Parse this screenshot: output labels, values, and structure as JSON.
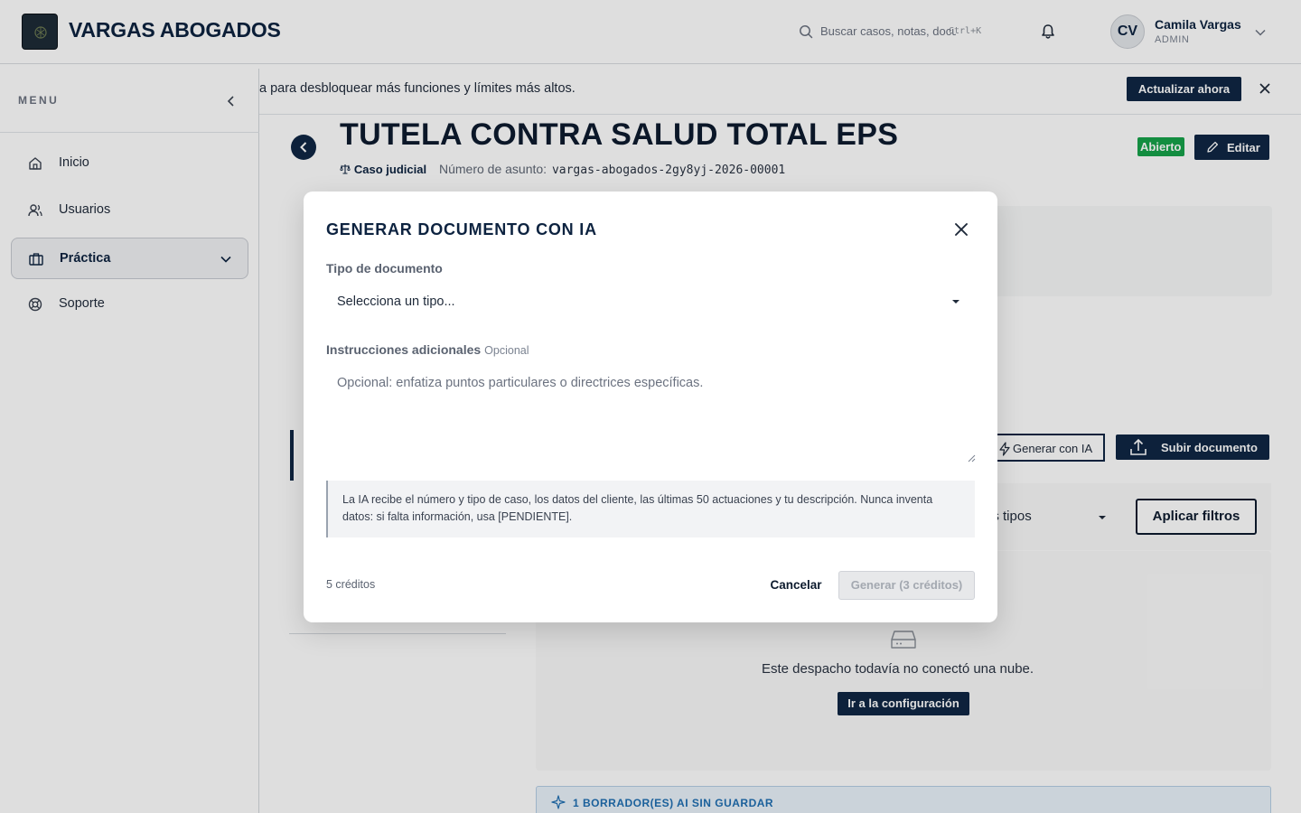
{
  "header": {
    "brand": "VARGAS ABOGADOS",
    "search_placeholder": "Buscar casos, notas, documentos...",
    "search_shortcut": "Ctrl+K",
    "user_initials": "CV",
    "user_name": "Camila Vargas",
    "user_role": "ADMIN"
  },
  "sidebar": {
    "menu_label": "MENU",
    "items": [
      {
        "label": "Inicio",
        "icon": "home-icon"
      },
      {
        "label": "Usuarios",
        "icon": "users-icon"
      },
      {
        "label": "Práctica",
        "icon": "briefcase-icon",
        "active": true
      },
      {
        "label": "Soporte",
        "icon": "lifebuoy-icon"
      }
    ]
  },
  "banner": {
    "text": "a para desbloquear más funciones y límites más altos.",
    "upgrade_label": "Actualizar ahora"
  },
  "case": {
    "title": "TUTELA CONTRA SALUD TOTAL EPS",
    "type": "Caso judicial",
    "number_label": "Número de asunto:",
    "number": "vargas-abogados-2gy8yj-2026-00001",
    "status": "Abierto",
    "edit_label": "Editar",
    "generate_ai_label": "Generar con IA",
    "upload_label": "Subir documento",
    "filter_value": "os tipos",
    "apply_filters_label": "Aplicar filtros",
    "cloud_message": "Este despacho todavía no conectó una nube.",
    "cloud_button": "Ir a la configuración",
    "drafts_notice": "1 BORRADOR(ES) AI SIN GUARDAR"
  },
  "modal": {
    "title": "GENERAR DOCUMENTO CON IA",
    "doc_type_label": "Tipo de documento",
    "doc_type_value": "Selecciona un tipo...",
    "instructions_label": "Instrucciones adicionales",
    "instructions_optional": "Opcional",
    "instructions_placeholder": "Opcional: enfatiza puntos particulares o directrices específicas.",
    "info_text": "La IA recibe el número y tipo de caso, los datos del cliente, las últimas 50 actuaciones y tu descripción. Nunca inventa datos: si falta información, usa [PENDIENTE].",
    "credits": "5 créditos",
    "cancel_label": "Cancelar",
    "generate_label": "Generar (3 créditos)"
  },
  "colors": {
    "primary": "#0f2744",
    "status_open": "#16a34a",
    "drafts_accent": "#1f6fb2"
  }
}
